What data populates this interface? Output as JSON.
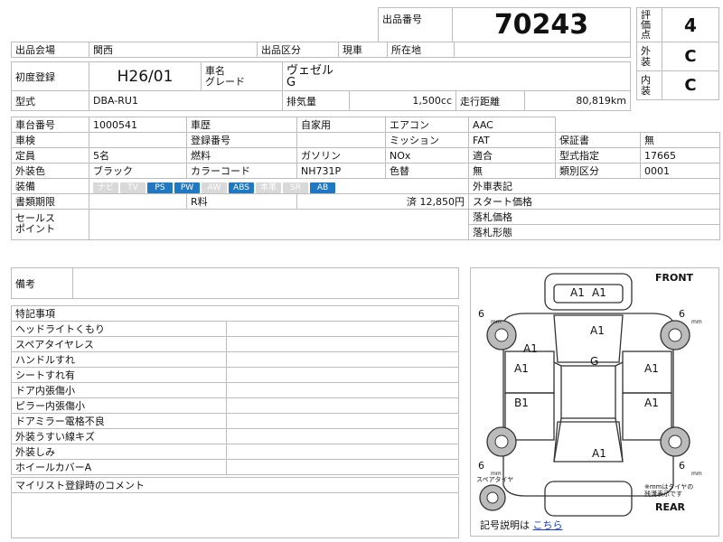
{
  "header": {
    "lot_label": "出品番号",
    "lot_number": "70243"
  },
  "scores": [
    {
      "label": "評価点",
      "value": "4"
    },
    {
      "label": "外装",
      "value": "C"
    },
    {
      "label": "内装",
      "value": "C"
    }
  ],
  "venue": {
    "venue_label": "出品会場",
    "venue_value": "関西",
    "category_label": "出品区分",
    "category_value": "現車",
    "location_label": "所在地",
    "location_value": ""
  },
  "vehicle": {
    "first_reg_label": "初度登録",
    "first_reg_value": "H26/01",
    "name_label": "車名\nグレード",
    "name_value": "ヴェゼル",
    "grade_value": "G",
    "model_label": "型式",
    "model_value": "DBA-RU1",
    "displacement_label": "排気量",
    "displacement_value": "1,500cc",
    "mileage_label": "走行距離",
    "mileage_value": "80,819km"
  },
  "specs": {
    "chassis_label": "車台番号",
    "chassis_value": "1000541",
    "history_label": "車歴",
    "history_value": "自家用",
    "aircon_label": "エアコン",
    "aircon_value": "AAC",
    "inspection_label": "車検",
    "inspection_value": "",
    "regno_label": "登録番号",
    "regno_value": "",
    "mission_label": "ミッション",
    "mission_value": "FAT",
    "warranty_label": "保証書",
    "warranty_value": "無",
    "capacity_label": "定員",
    "capacity_value": "5名",
    "fuel_label": "燃料",
    "fuel_value": "ガソリン",
    "nox_label": "NOx",
    "nox_value": "",
    "compliance_label": "適合",
    "compliance_value": "",
    "model_designation_label": "型式指定",
    "model_designation_value": "17665",
    "exterior_color_label": "外装色",
    "exterior_color_value": "ブラック",
    "color_code_label": "カラーコード",
    "color_code_value": "NH731P",
    "color_change_label": "色替",
    "color_change_value": "無",
    "category_class_label": "類別区分",
    "category_class_value": "0001",
    "equipment_label": "装備",
    "equipment": [
      {
        "name": "ナビ",
        "on": false
      },
      {
        "name": "TV",
        "on": false
      },
      {
        "name": "PS",
        "on": true
      },
      {
        "name": "PW",
        "on": true
      },
      {
        "name": "AW",
        "on": false
      },
      {
        "name": "ABS",
        "on": true
      },
      {
        "name": "本革",
        "on": false
      },
      {
        "name": "SR",
        "on": false
      },
      {
        "name": "AB",
        "on": true
      }
    ],
    "inspection_record_label": "外車表記",
    "docs_label": "書類期限",
    "docs_value": "",
    "recycle_label": "R料",
    "recycle_value": "済 12,850円",
    "start_price_label": "スタート価格",
    "sales_point_label": "セールス\nポイント",
    "sold_price_label": "落札価格",
    "sold_type_label": "落札形態"
  },
  "remarks": {
    "label": "備考",
    "notes_title": "特記事項",
    "notes": [
      "ヘッドライトくもり",
      "スペアタイヤレス",
      "ハンドルすれ",
      "シートすれ有",
      "ドア内張傷小",
      "ピラー内張傷小",
      "ドアミラー電格不良",
      "外装うすい線キズ",
      "外装しみ",
      "ホイールカバーA"
    ],
    "mylist_label": "マイリスト登録時のコメント"
  },
  "diagram": {
    "front_label": "FRONT",
    "rear_label": "REAR",
    "spare_label": "スペアタイヤ",
    "tire_note": "※mmはタイヤの\n残溝表示です",
    "tire_depths": [
      "6",
      "6",
      "6",
      "6"
    ],
    "tire_unit": "mm",
    "marks": {
      "hood_left": "A1",
      "hood_right": "A1",
      "front_bumper_left": "A1",
      "roof_front": "A1",
      "roof_g": "G",
      "left_front_door": "A1",
      "left_rear_door": "B1",
      "right_front_door": "A1",
      "right_rear_door": "A1",
      "rear": "A1"
    },
    "legend_text": "記号説明は",
    "legend_link": "こちら"
  }
}
